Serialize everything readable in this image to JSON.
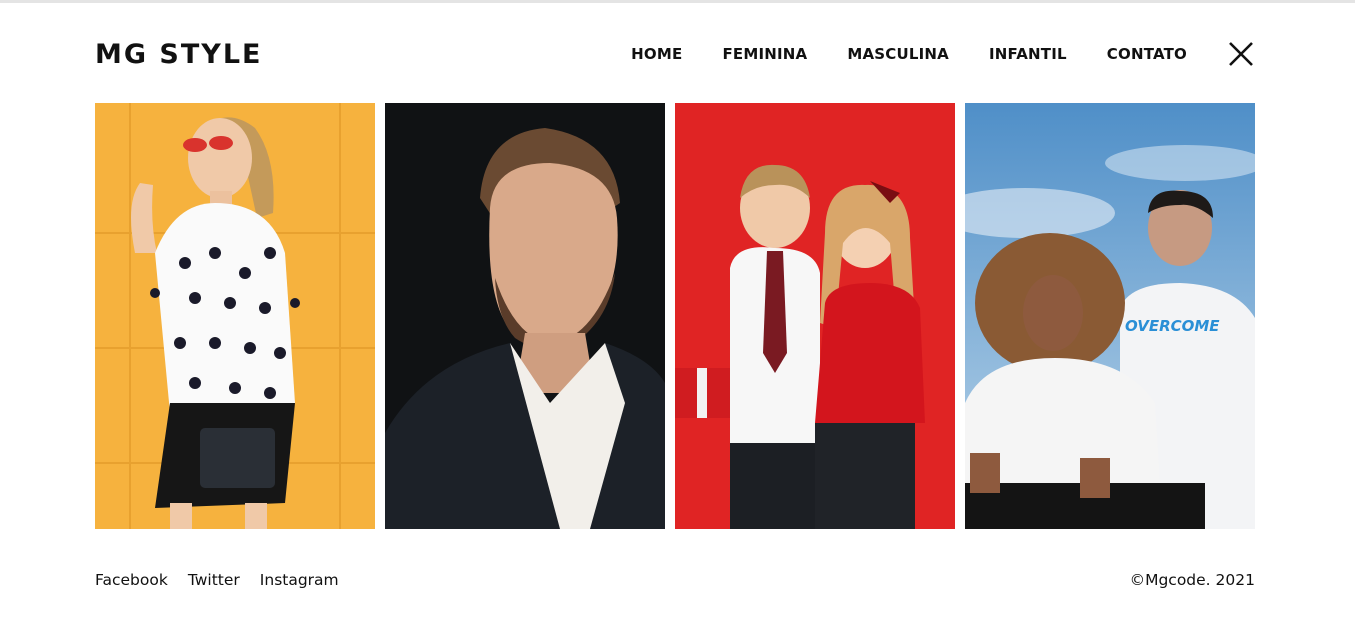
{
  "brand": {
    "logo": "MG STYLE"
  },
  "nav": {
    "items": [
      {
        "label": "HOME"
      },
      {
        "label": "FEMININA"
      },
      {
        "label": "MASCULINA"
      },
      {
        "label": "INFANTIL"
      },
      {
        "label": "CONTATO"
      }
    ],
    "close_icon": "close-icon"
  },
  "gallery": {
    "cards": [
      {
        "icon": "woman-photo",
        "shirt_text": ""
      },
      {
        "icon": "man-photo",
        "shirt_text": ""
      },
      {
        "icon": "kids-photo",
        "shirt_text": ""
      },
      {
        "icon": "couple-photo",
        "shirt_text": "OVERCOME"
      }
    ]
  },
  "footer": {
    "social": [
      {
        "label": "Facebook"
      },
      {
        "label": "Twitter"
      },
      {
        "label": "Instagram"
      }
    ],
    "copyright": "©Mgcode. 2021"
  },
  "colors": {
    "text": "#111111",
    "card1_bg": "#f6b23e",
    "card2_bg": "#101214",
    "card3_bg": "#e02424",
    "card4_sky": "#4f8fc8"
  }
}
